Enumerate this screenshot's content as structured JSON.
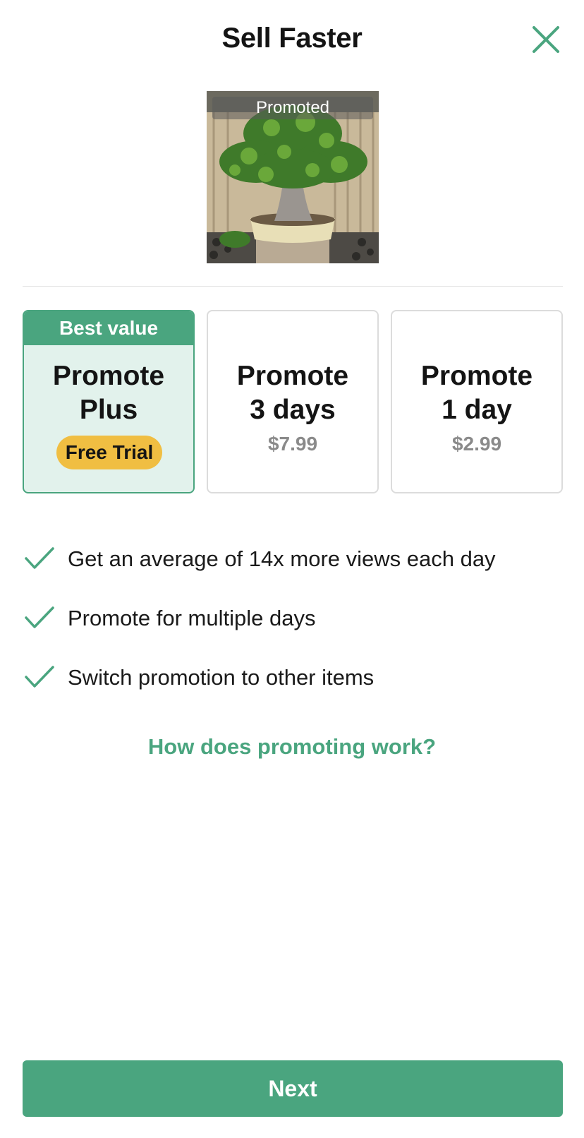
{
  "header": {
    "title": "Sell Faster",
    "close_icon": "close-icon"
  },
  "listing_photo": {
    "tag_label": "Promoted"
  },
  "plans": [
    {
      "badge": "Best value",
      "name_line1": "Promote",
      "name_line2": "Plus",
      "pill": "Free Trial",
      "selected": true
    },
    {
      "name_line1": "Promote",
      "name_line2": "3 days",
      "price": "$7.99",
      "selected": false
    },
    {
      "name_line1": "Promote",
      "name_line2": "1 day",
      "price": "$2.99",
      "selected": false
    }
  ],
  "features": [
    {
      "icon": "checkmark-icon",
      "text": "Get an average of 14x more views each day"
    },
    {
      "icon": "checkmark-icon",
      "text": "Promote for multiple days"
    },
    {
      "icon": "checkmark-icon",
      "text": "Switch promotion to other items"
    }
  ],
  "help_link": "How does promoting work?",
  "next_button": "Next",
  "colors": {
    "accent": "#4aa57f",
    "selected_bg": "#e2f2ec",
    "trial_pill": "#f0be42",
    "price_text": "#8a8a8a"
  }
}
